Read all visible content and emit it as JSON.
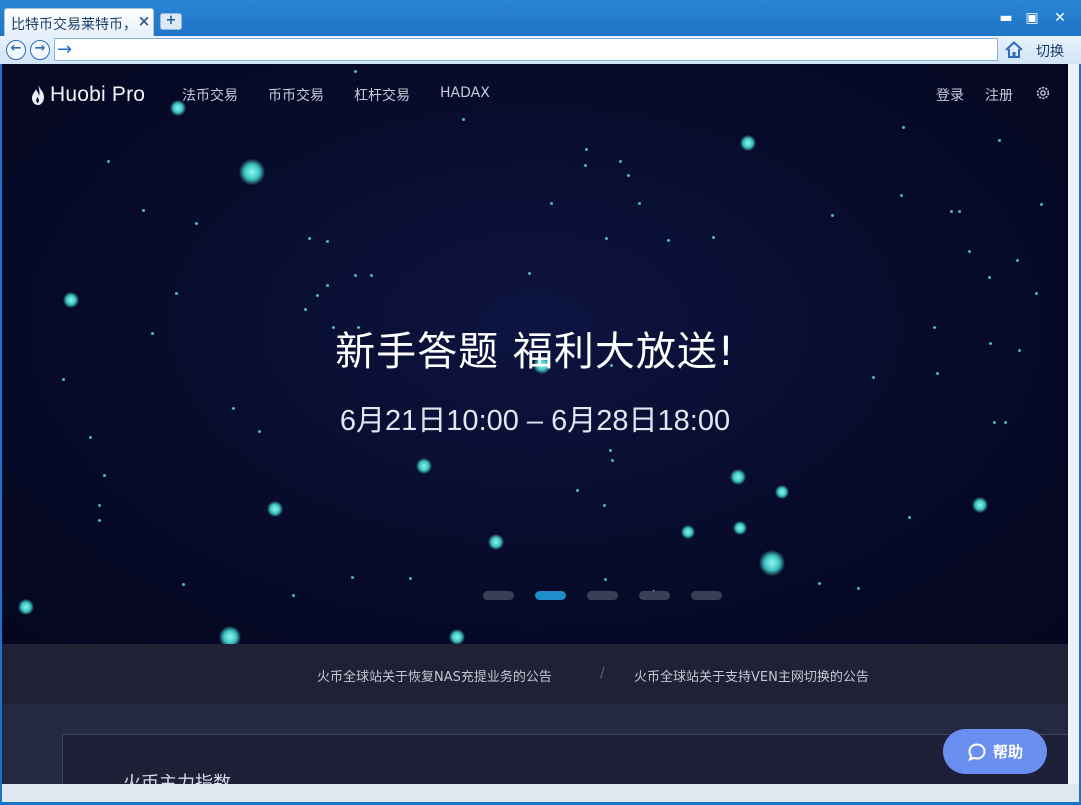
{
  "browser": {
    "tab_title": "比特币交易莱特币，",
    "tab_close": "×",
    "new_tab": "+",
    "minimize": "▬",
    "maximize": "▣",
    "close": "✕",
    "back": "←",
    "forward": "→",
    "address_arrow": "→",
    "address_value": "",
    "switch_label": "切换"
  },
  "site": {
    "logo": "Huobi Pro",
    "menu": [
      "法币交易",
      "币币交易",
      "杠杆交易",
      "HADAX"
    ],
    "login": "登录",
    "register": "注册"
  },
  "hero": {
    "headline": "新手答题 福利大放送!",
    "dates": "6月21日10:00 – 6月28日18:00",
    "active_slide": 2,
    "slide_count": 5
  },
  "notices": [
    "火币全球站关于恢复NAS充提业务的公告",
    "火币全球站关于支持VEN主网切换的公告"
  ],
  "notice_separator": "/",
  "section": {
    "title": "火币主力指数"
  },
  "help": {
    "label": "帮助"
  },
  "colors": {
    "browser_blue": "#1f74c6",
    "hero_background": "#070a28",
    "star_cyan": "#5fe0dc",
    "active_dot": "#1d8ec9",
    "help_button": "#6a8ff0"
  }
}
